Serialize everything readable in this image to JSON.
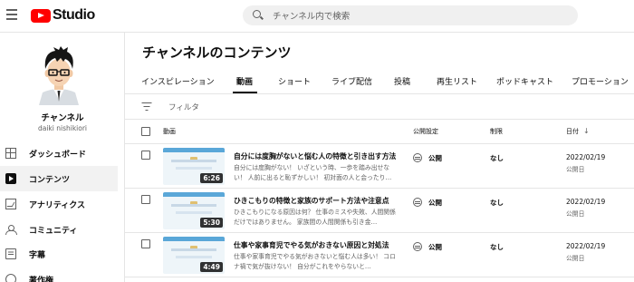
{
  "app": {
    "logo_text": "Studio"
  },
  "search": {
    "placeholder": "チャンネル内で検索"
  },
  "channel": {
    "name": "チャンネル",
    "handle": "daiki nishikiori"
  },
  "sidebar": {
    "items": [
      {
        "label": "ダッシュボード",
        "icon": "dashboard-icon"
      },
      {
        "label": "コンテンツ",
        "icon": "content-icon",
        "active": true
      },
      {
        "label": "アナリティクス",
        "icon": "analytics-icon"
      },
      {
        "label": "コミュニティ",
        "icon": "community-icon"
      },
      {
        "label": "字幕",
        "icon": "subtitles-icon"
      },
      {
        "label": "著作権",
        "icon": "copyright-icon"
      }
    ]
  },
  "page": {
    "title": "チャンネルのコンテンツ"
  },
  "tabs": [
    {
      "label": "インスピレーション"
    },
    {
      "label": "動画",
      "active": true
    },
    {
      "label": "ショート"
    },
    {
      "label": "ライブ配信"
    },
    {
      "label": "投稿"
    },
    {
      "label": "再生リスト"
    },
    {
      "label": "ポッドキャスト"
    },
    {
      "label": "プロモーション"
    }
  ],
  "filter": {
    "label": "フィルタ"
  },
  "table": {
    "headers": {
      "video": "動画",
      "visibility": "公開設定",
      "restrictions": "制限",
      "date": "日付"
    },
    "rows": [
      {
        "title": "自分には度胸がないと悩む人の特徴と引き出す方法",
        "description": "自分には度胸がない！ いざという時、一歩を踏み出せない！ 人前に出ると恥ずかしい！ 初対面の人と会ったり…",
        "duration": "6:26",
        "visibility": "公開",
        "restrictions": "なし",
        "date": "2022/02/19",
        "date_status": "公開日"
      },
      {
        "title": "ひきこもりの特徴と家族のサポート方法や注意点",
        "description": "ひきこもりになる原因は何？ 仕事のミスや失敗、人間関係だけではありません。 家族間の人間関係も引き金…",
        "duration": "5:30",
        "visibility": "公開",
        "restrictions": "なし",
        "date": "2022/02/19",
        "date_status": "公開日"
      },
      {
        "title": "仕事や家事育児でやる気がおきない原因と対処法",
        "description": "仕事や家事育児でやる気がおきないと悩む人は多い！ コロナ禍で気が抜けない！ 自分がこれをやらないと…",
        "duration": "4:49",
        "visibility": "公開",
        "restrictions": "なし",
        "date": "2022/02/19",
        "date_status": "公開日"
      }
    ]
  }
}
